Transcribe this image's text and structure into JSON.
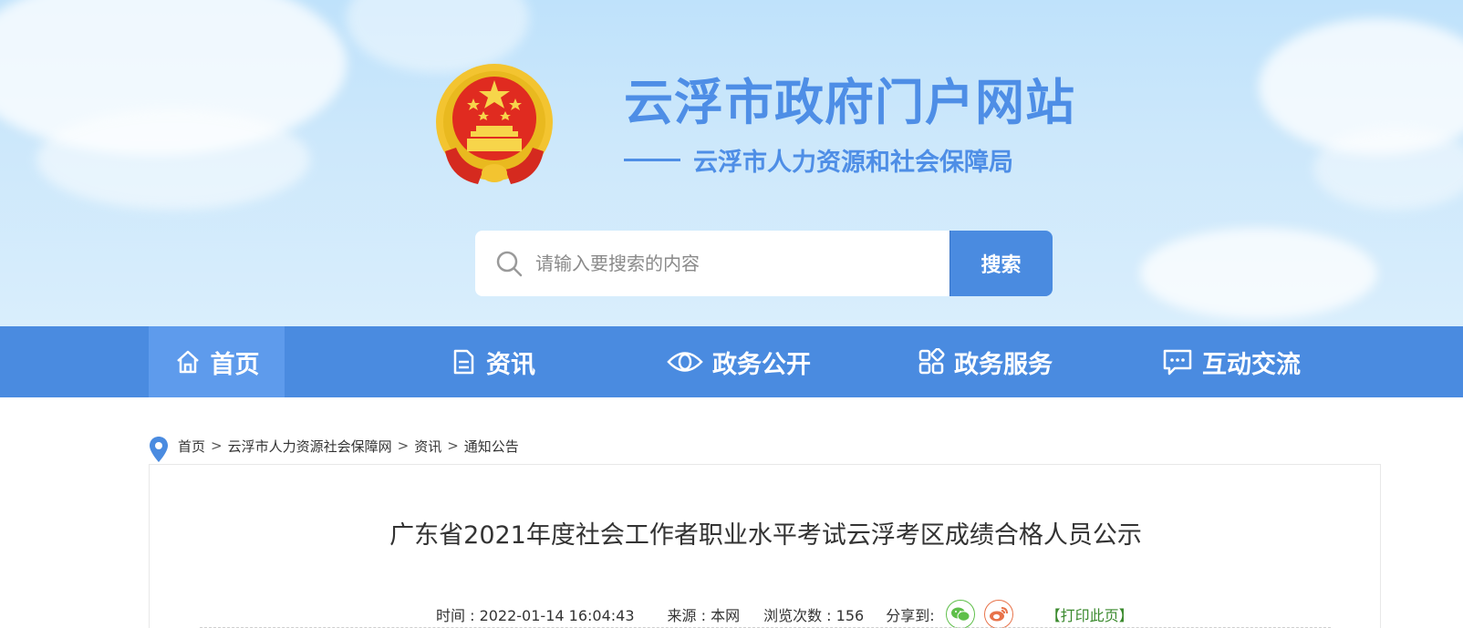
{
  "header": {
    "site_title": "云浮市政府门户网站",
    "site_subtitle": "云浮市人力资源和社会保障局",
    "emblem_icon": "national-emblem-icon"
  },
  "search": {
    "placeholder": "请输入要搜索的内容",
    "button_label": "搜索"
  },
  "nav": {
    "items": [
      {
        "label": "首页",
        "icon": "home-icon"
      },
      {
        "label": "资讯",
        "icon": "document-icon"
      },
      {
        "label": "政务公开",
        "icon": "eye-icon"
      },
      {
        "label": "政务服务",
        "icon": "grid-icon"
      },
      {
        "label": "互动交流",
        "icon": "chat-icon"
      }
    ],
    "active_index": 0
  },
  "breadcrumb": {
    "items": [
      "首页",
      "云浮市人力资源社会保障网",
      "资讯",
      "通知公告"
    ],
    "separator": ">"
  },
  "article": {
    "title": "广东省2021年度社会工作者职业水平考试云浮考区成绩合格人员公示",
    "time": "时间 : 2022-01-14 16:04:43",
    "source": "来源 : 本网",
    "views": "浏览次数 : 156",
    "share_label": "分享到:",
    "print_label": "【打印此页】"
  },
  "colors": {
    "brand_blue": "#4a8be0",
    "title_blue": "#4e8ee6",
    "print_green": "#3b8a2e"
  }
}
